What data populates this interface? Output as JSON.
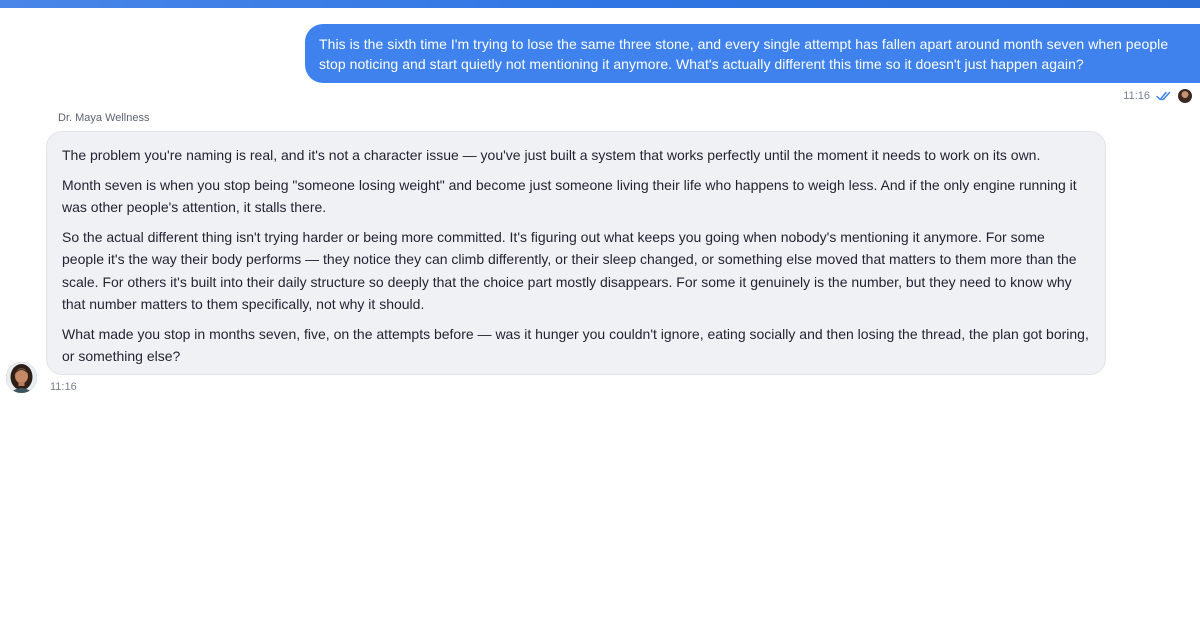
{
  "colors": {
    "accent": "#3f82ee",
    "incoming_bubble": "#f0f1f5",
    "top_bar": "#2f76e4"
  },
  "conversation": {
    "outgoing": {
      "text": "This is the sixth time I'm trying to lose the same three stone, and every single attempt has fallen apart around month seven when people stop noticing and start quietly not mentioning it anymore. What's actually different this time so it doesn't just happen again?",
      "time": "11:16",
      "status_icon": "double-check-icon"
    },
    "incoming": {
      "sender": "Dr. Maya Wellness",
      "paragraphs": [
        "The problem you're naming is real, and it's not a character issue — you've just built a system that works perfectly until the moment it needs to work on its own.",
        "Month seven is when you stop being \"someone losing weight\" and become just someone living their life who happens to weigh less. And if the only engine running it was other people's attention, it stalls there.",
        "So the actual different thing isn't trying harder or being more committed. It's figuring out what keeps you going when nobody's mentioning it anymore. For some people it's the way their body performs — they notice they can climb differently, or their sleep changed, or something else moved that matters to them more than the scale. For others it's built into their daily structure so deeply that the choice part mostly disappears. For some it genuinely is the number, but they need to know why that number matters to them specifically, not why it should.",
        "What made you stop in months seven, five, on the attempts before — was it hunger you couldn't ignore, eating socially and then losing the thread, the plan got boring, or something else?"
      ],
      "time": "11:16"
    }
  }
}
